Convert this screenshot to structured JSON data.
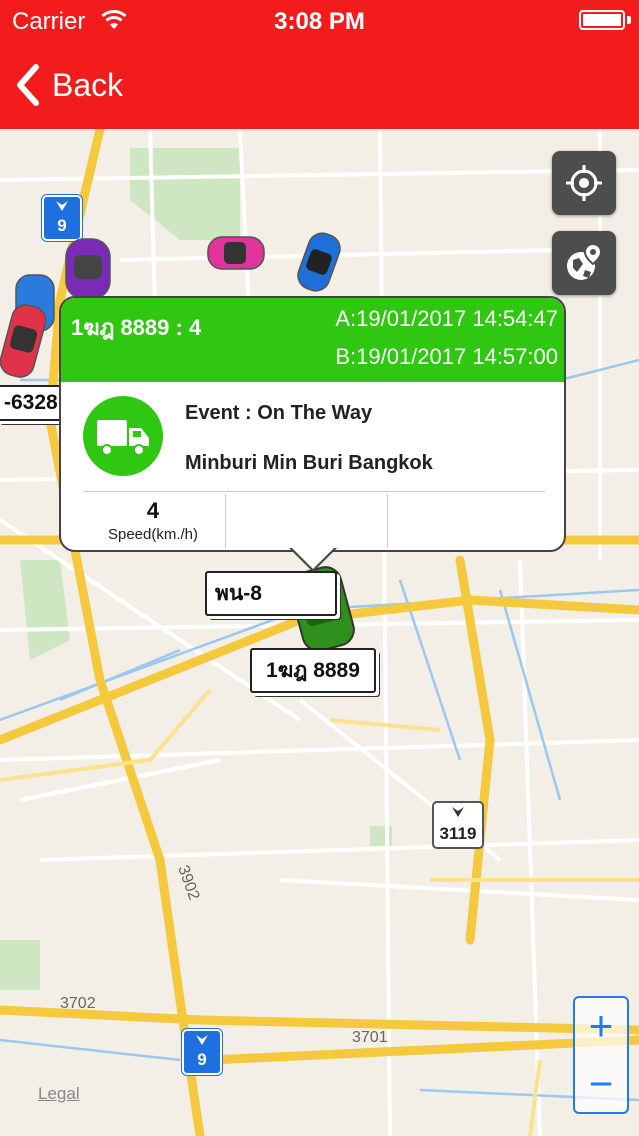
{
  "status_bar": {
    "carrier": "Carrier",
    "time": "3:08 PM"
  },
  "nav": {
    "back_label": "Back"
  },
  "map": {
    "legal": "Legal",
    "road_labels": [
      "3902",
      "3702",
      "3701"
    ],
    "highway_shields": [
      {
        "number": "9"
      },
      {
        "number": "9"
      },
      {
        "number": "3119"
      }
    ],
    "vehicle_labels": [
      "-6328",
      "พน-8",
      "1ฆฎ 8889"
    ],
    "zoom_in": "+",
    "zoom_out": "−"
  },
  "popup": {
    "title": "1ฆฎ 8889 : 4",
    "time_a": "A:19/01/2017 14:54:47",
    "time_b": "B:19/01/2017 14:57:00",
    "event": "Event : On The Way",
    "location": "Minburi Min Buri Bangkok",
    "stats": [
      {
        "value": "4",
        "label": "Speed(km./h)"
      },
      {
        "value": "",
        "label": ""
      },
      {
        "value": "",
        "label": ""
      }
    ]
  },
  "colors": {
    "header": "#f21c1c",
    "accent_green": "#2fc712",
    "zoom_blue": "#1e7bf0"
  },
  "icons": {
    "back": "chevron-left-icon",
    "locate": "crosshair-icon",
    "map_type": "globe-pin-icon",
    "event": "truck-icon"
  }
}
